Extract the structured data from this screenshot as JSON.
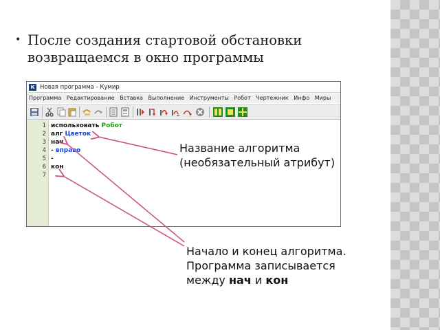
{
  "bullet": {
    "marker": "•",
    "text_line1": "После создания стартовой обстановки",
    "text_line2": "возвращаемся в окно программы"
  },
  "window": {
    "icon_letter": "К",
    "title": "Новая программа - Кумир",
    "menu": [
      "Программа",
      "Редактирование",
      "Вставка",
      "Выполнение",
      "Инструменты",
      "Робот",
      "Чертежник",
      "Инфо",
      "Миры"
    ]
  },
  "toolbar_icons": [
    "save-icon",
    "cut-icon",
    "copy-icon",
    "paste-icon",
    "undo-icon",
    "redo-icon",
    "document-icon",
    "document2-icon",
    "run-icon",
    "step-icon",
    "step-into-icon",
    "step-out-icon",
    "step-over-icon",
    "stop-icon",
    "robot-grid-icon",
    "robot-window-icon",
    "robot-plus-icon"
  ],
  "editor": {
    "line_numbers": [
      "1",
      "2",
      "3",
      "4",
      "5",
      "6",
      "7"
    ],
    "lines": [
      {
        "kw": "использовать ",
        "arg": "Робот",
        "arg_color": "green"
      },
      {
        "kw": "алг ",
        "arg": "Цветок",
        "arg_color": "blue"
      },
      {
        "kw": "нач",
        "arg": "",
        "arg_color": ""
      },
      {
        "kw": "-  ",
        "arg": "вправо",
        "arg_color": "blue"
      },
      {
        "kw": "-",
        "arg": "",
        "arg_color": ""
      },
      {
        "kw": "кон",
        "arg": "",
        "arg_color": ""
      },
      {
        "kw": "",
        "arg": "",
        "arg_color": ""
      }
    ]
  },
  "callouts": {
    "name_line1": "Название алгоритма",
    "name_line2": "(необязательный атрибут)",
    "start_line1": "Начало и конец алгоритма.",
    "start_line2": "Программа записывается",
    "start_line3_pre": "между ",
    "start_line3_b1": "нач",
    "start_line3_mid": " и ",
    "start_line3_b2": "кон"
  },
  "colors": {
    "arrow": "#c8507a",
    "gutter": "#e4ecd6",
    "keyword_green": "#1a9e1a",
    "keyword_blue": "#1a44c7"
  }
}
